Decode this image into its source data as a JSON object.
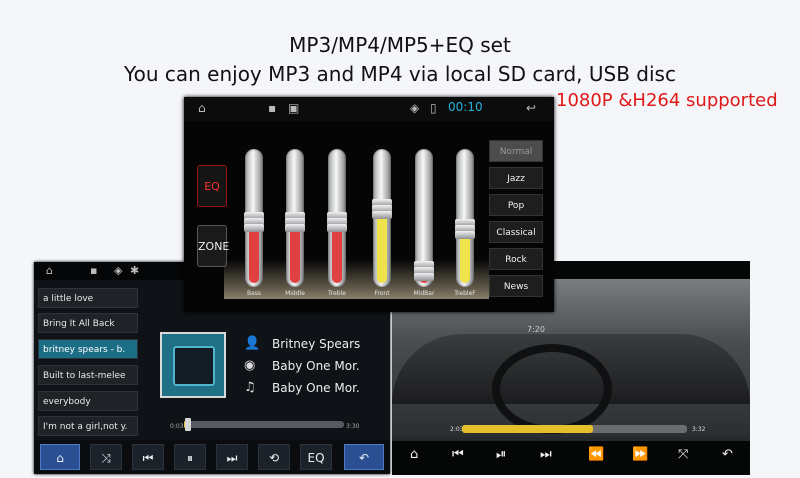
{
  "headline": {
    "line1": "MP3/MP4/MP5+EQ set",
    "line2": "You can enjoy MP3 and MP4 via local SD card, USB disc",
    "note": "1080P &H264 supported"
  },
  "eq_panel": {
    "status_time": "00:10",
    "side_buttons": {
      "eq": "EQ",
      "zone": "ZONE"
    },
    "bands": [
      {
        "label": "Bass",
        "level": 0.45,
        "color": "#e04040"
      },
      {
        "label": "Middle",
        "level": 0.45,
        "color": "#e04040"
      },
      {
        "label": "Treble",
        "level": 0.45,
        "color": "#e04040"
      },
      {
        "label": "Front",
        "level": 0.55,
        "color": "#f0e24a"
      },
      {
        "label": "MidBar",
        "level": 0.08,
        "color": "#e04040"
      },
      {
        "label": "TrebleF",
        "level": 0.4,
        "color": "#f0e24a"
      }
    ],
    "presets": [
      "Normal",
      "Jazz",
      "Pop",
      "Classical",
      "Rock",
      "News"
    ],
    "selected_preset": "Normal"
  },
  "music_player": {
    "songs": [
      "a little love",
      "Bring It All Back",
      "britney spears - b.",
      "Built to last-melee",
      "everybody",
      "I'm not a girl,not y."
    ],
    "active_index": 2,
    "artist": "Britney Spears",
    "album": "Baby One Mor.",
    "track": "Baby One Mor.",
    "time_elapsed": "0:03",
    "time_total": "3:30",
    "progress": 0.02,
    "controls": {
      "eq_label": "EQ"
    }
  },
  "video_player": {
    "clock": "7:20",
    "time_elapsed": "2:03",
    "time_total": "3:32",
    "progress": 0.58
  },
  "colors": {
    "accent_blue": "#22b2de",
    "eq_red": "#e04040",
    "eq_yellow": "#f0e24a",
    "note_red": "#e01818"
  }
}
